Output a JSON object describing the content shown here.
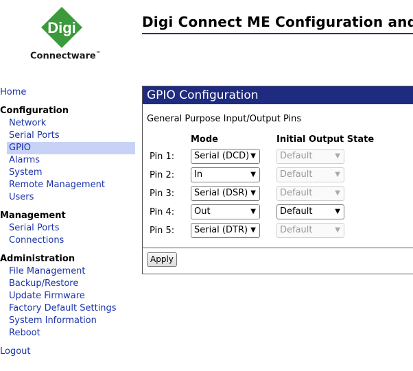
{
  "logo": {
    "text": "Connectware",
    "tm": "™",
    "mark": "Digi"
  },
  "page_title": "Digi Connect ME Configuration and",
  "sidebar": {
    "home": "Home",
    "configuration": {
      "heading": "Configuration",
      "items": [
        "Network",
        "Serial Ports",
        "GPIO",
        "Alarms",
        "System",
        "Remote Management",
        "Users"
      ],
      "active_index": 2
    },
    "management": {
      "heading": "Management",
      "items": [
        "Serial Ports",
        "Connections"
      ]
    },
    "administration": {
      "heading": "Administration",
      "items": [
        "File Management",
        "Backup/Restore",
        "Update Firmware",
        "Factory Default Settings",
        "System Information",
        "Reboot"
      ]
    },
    "logout": "Logout"
  },
  "panel": {
    "title": "GPIO Configuration",
    "subtitle": "General Purpose Input/Output Pins",
    "col_mode": "Mode",
    "col_state": "Initial Output State",
    "pins": [
      {
        "label": "Pin 1:",
        "mode": "Serial (DCD)",
        "state": "Default",
        "state_enabled": false
      },
      {
        "label": "Pin 2:",
        "mode": "In",
        "state": "Default",
        "state_enabled": false
      },
      {
        "label": "Pin 3:",
        "mode": "Serial (DSR)",
        "state": "Default",
        "state_enabled": false
      },
      {
        "label": "Pin 4:",
        "mode": "Out",
        "state": "Default",
        "state_enabled": true
      },
      {
        "label": "Pin 5:",
        "mode": "Serial (DTR)",
        "state": "Default",
        "state_enabled": false
      }
    ],
    "apply_label": "Apply"
  },
  "colors": {
    "brand_green": "#3c9a3c",
    "header_bg": "#1f2b80",
    "link": "#1a33aa",
    "active_bg": "#c7d2f6"
  }
}
